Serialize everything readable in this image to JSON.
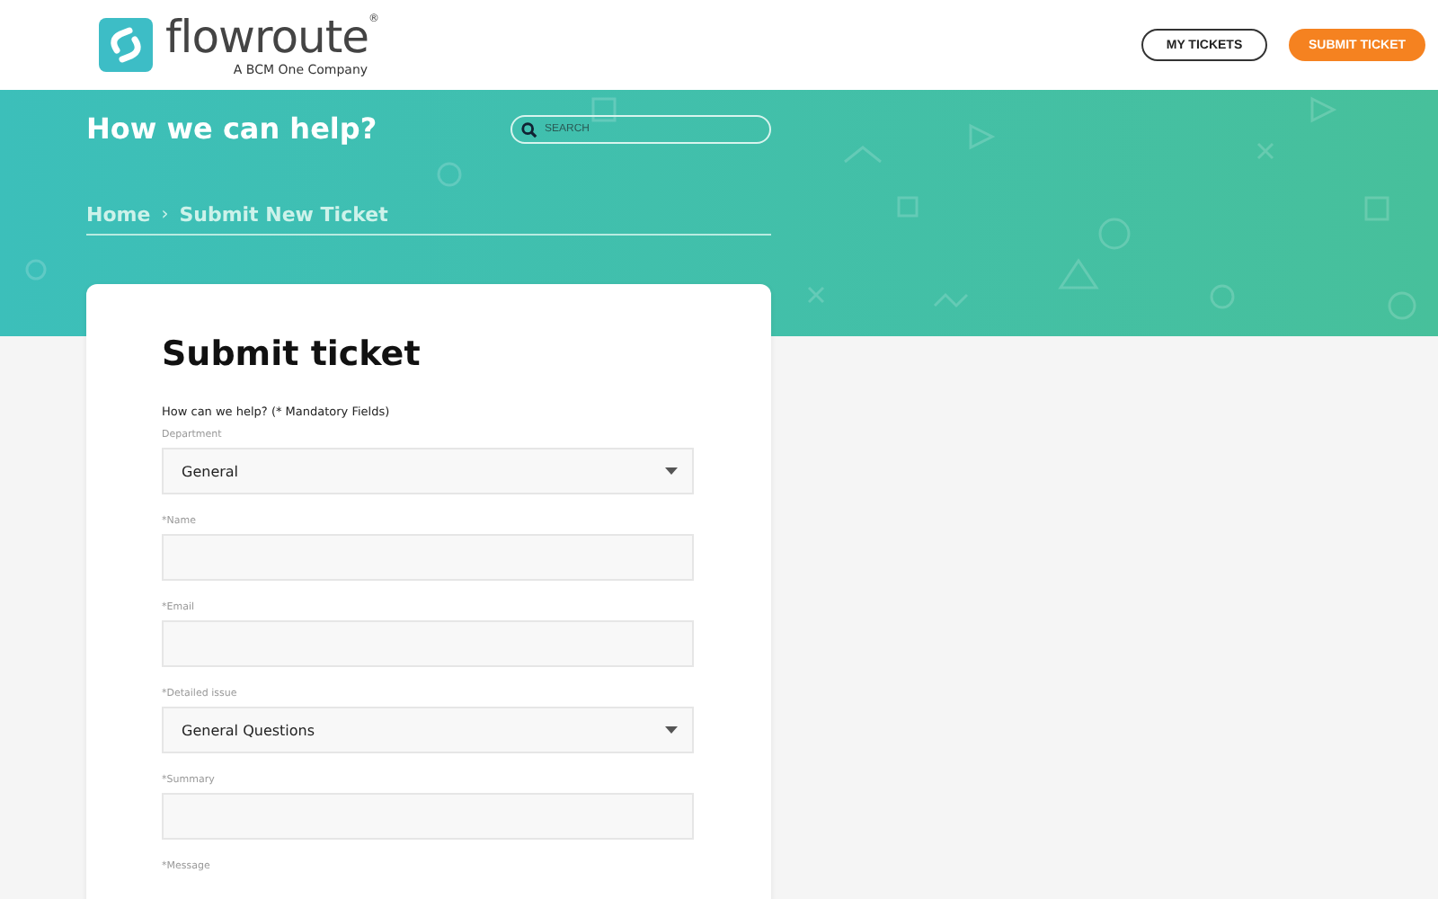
{
  "header": {
    "logo_name": "flowroute",
    "logo_mark": "®",
    "tagline": "A BCM One Company",
    "buttons": [
      {
        "label": "MY TICKETS",
        "kind": "outline"
      },
      {
        "label": "SUBMIT TICKET",
        "kind": "primary"
      }
    ]
  },
  "banner": {
    "title": "How we can help?",
    "search": {
      "placeholder": "SEARCH"
    },
    "breadcrumb": [
      "Home",
      "Submit New Ticket"
    ],
    "separator": "›"
  },
  "form": {
    "title": "Submit ticket",
    "intro": "How can we help? (* Mandatory Fields)",
    "fields": [
      {
        "label": "Department",
        "kind": "select",
        "value": "General"
      },
      {
        "label": "*Name",
        "kind": "text"
      },
      {
        "label": "*Email",
        "kind": "text"
      },
      {
        "label": "*Detailed issue",
        "kind": "select",
        "value": "General Questions"
      },
      {
        "label": "*Summary",
        "kind": "text"
      },
      {
        "label": "*Message",
        "kind": "label"
      }
    ]
  }
}
